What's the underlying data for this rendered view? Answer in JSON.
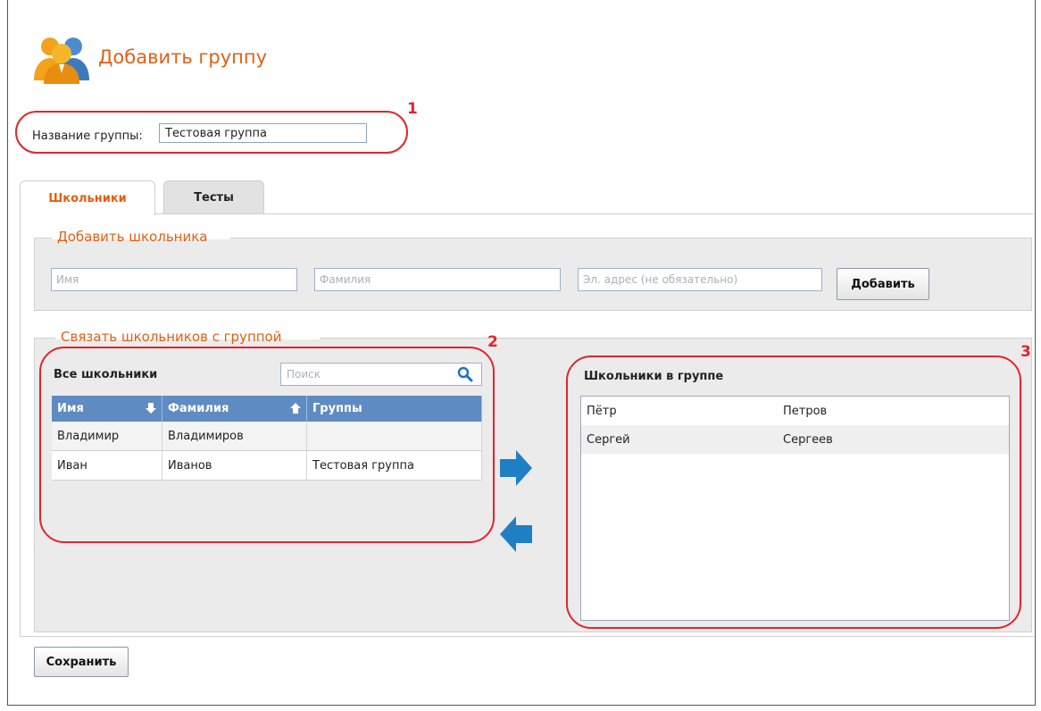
{
  "page": {
    "title": "Добавить группу"
  },
  "group_name": {
    "label": "Название группы:",
    "value": "Тестовая группа"
  },
  "tabs": [
    {
      "label": "Школьники",
      "active": true
    },
    {
      "label": "Тесты",
      "active": false
    }
  ],
  "add_student": {
    "legend": "Добавить школьника",
    "first_name_placeholder": "Имя",
    "last_name_placeholder": "Фамилия",
    "email_placeholder": "Эл. адрес (не обязательно)",
    "add_button": "Добавить"
  },
  "link_students": {
    "legend": "Связать школьников с группой",
    "all_students": {
      "title": "Все школьники",
      "search_placeholder": "Поиск",
      "columns": [
        "Имя",
        "Фамилия",
        "Группы"
      ],
      "rows": [
        [
          "Владимир",
          "Владимиров",
          ""
        ],
        [
          "Иван",
          "Иванов",
          "Тестовая группа"
        ]
      ]
    },
    "group_students": {
      "title": "Школьники в группе",
      "rows": [
        [
          "Пётр",
          "Петров"
        ],
        [
          "Сергей",
          "Сергеев"
        ]
      ]
    }
  },
  "annotations": [
    "1",
    "2",
    "3"
  ],
  "save_button": "Сохранить",
  "colors": {
    "accent_orange": "#e35f12",
    "annotation_red": "#e3242b",
    "grid_header_blue": "#5f8bc3",
    "arrow_blue": "#1f7fc4"
  },
  "icons": {
    "header": "users-group-icon",
    "search": "search-icon",
    "sort_name": "arrow-down-icon",
    "sort_surname": "arrow-up-icon",
    "move_right": "arrow-right-icon",
    "move_left": "arrow-left-icon"
  }
}
